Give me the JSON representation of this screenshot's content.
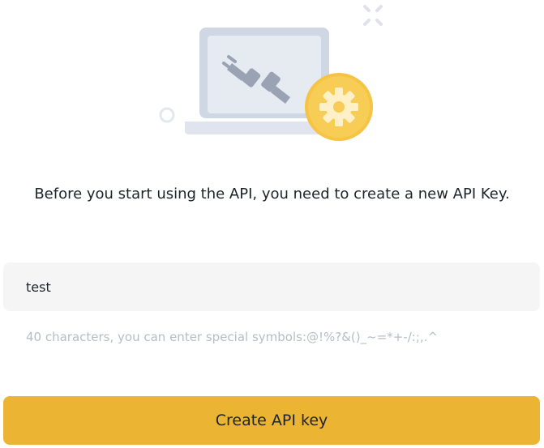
{
  "illustration": {
    "icons": [
      "laptop-icon",
      "unplugged-connector-icon",
      "gear-icon",
      "sparkle-icon",
      "ring-icon"
    ],
    "colors": {
      "laptop_screen": "#cfd6e4",
      "laptop_base": "#dfe4ee",
      "gear_circle": "#f6c445",
      "gear": "#fff0c8"
    }
  },
  "message": {
    "text": "Before you start using the API, you need to create a new API Key."
  },
  "api_key_form": {
    "label_input_value": "test",
    "label_input_placeholder": "",
    "hint": "40 characters, you can enter special symbols:@!%?&()_~=*+-/:;,.^",
    "create_button_label": "Create API key"
  },
  "colors": {
    "accent": "#ebb433",
    "input_background": "#f5f5f5",
    "text_primary": "#1e2329",
    "text_hint": "#b7bdc6"
  }
}
